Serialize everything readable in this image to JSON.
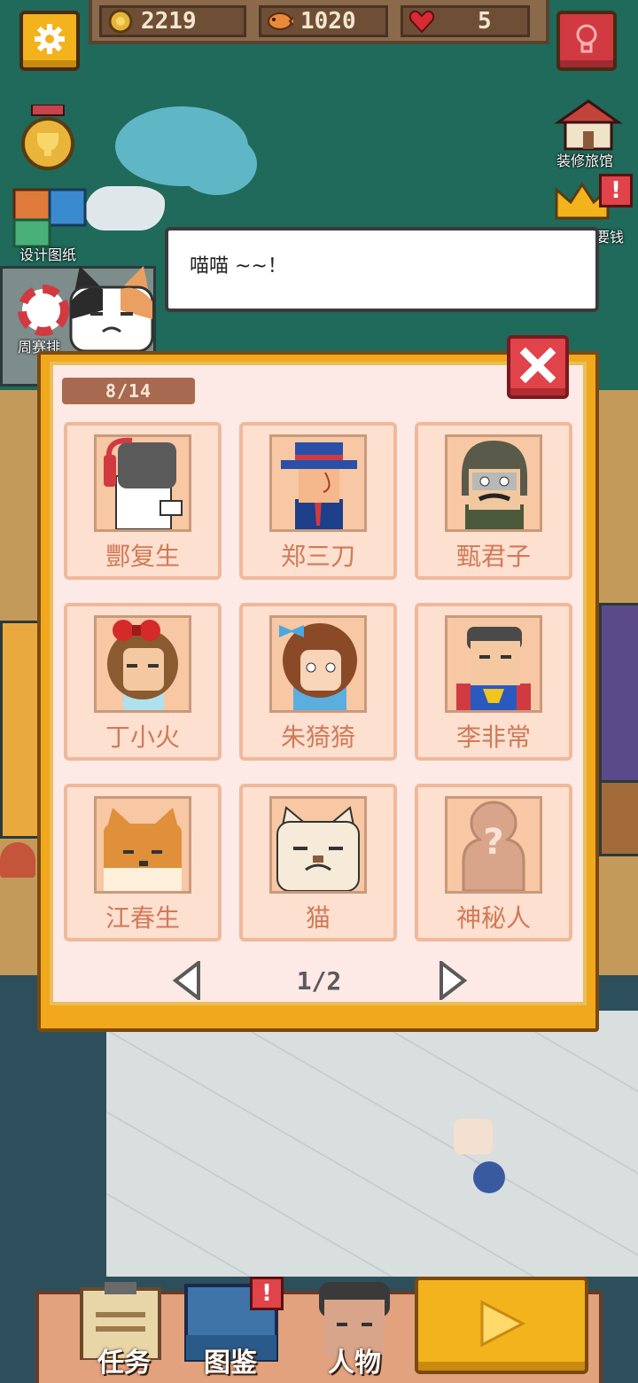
{
  "hud": {
    "coins": "2219",
    "fish": "1020",
    "hearts": "5"
  },
  "side_menu": {
    "design_label": "设计图纸",
    "weekly_label": "周赛排",
    "decorate_label": "装修旅馆",
    "money_label": "要钱"
  },
  "speech": {
    "text": "喵喵 ~~！"
  },
  "collection": {
    "counter": "8/14",
    "page": "1/2",
    "characters": [
      {
        "name": "酆复生"
      },
      {
        "name": "郑三刀"
      },
      {
        "name": "甄君子"
      },
      {
        "name": "丁小火"
      },
      {
        "name": "朱猗猗"
      },
      {
        "name": "李非常"
      },
      {
        "name": "江春生"
      },
      {
        "name": "猫"
      },
      {
        "name": "神秘人"
      }
    ]
  },
  "bottom_tabs": {
    "task": "任务",
    "album": "图鉴",
    "people": "人物",
    "album_badge": "!"
  },
  "colors": {
    "modal_frame": "#f2a81c",
    "card_bg": "#fde0cf",
    "name_text": "#d07a5a",
    "close_red": "#e0434a"
  }
}
